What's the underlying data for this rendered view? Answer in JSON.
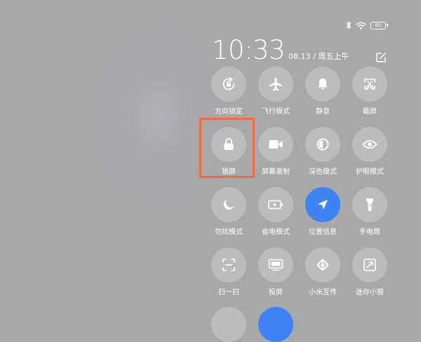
{
  "status_bar": {
    "battery": "80"
  },
  "header": {
    "time": "10:33",
    "date": "08.13 / 周五上午"
  },
  "tiles": [
    {
      "label": "方向锁定",
      "icon": "rotation-lock-icon",
      "active": false
    },
    {
      "label": "飞行模式",
      "icon": "airplane-icon",
      "active": false
    },
    {
      "label": "静音",
      "icon": "bell-icon",
      "active": false
    },
    {
      "label": "截屏",
      "icon": "screenshot-icon",
      "active": false
    },
    {
      "label": "锁屏",
      "icon": "lock-icon",
      "active": false
    },
    {
      "label": "屏幕录制",
      "icon": "video-camera-icon",
      "active": false
    },
    {
      "label": "深色模式",
      "icon": "dark-mode-icon",
      "active": false
    },
    {
      "label": "护眼模式",
      "icon": "eye-icon",
      "active": false
    },
    {
      "label": "勿扰模式",
      "icon": "moon-icon",
      "active": false
    },
    {
      "label": "省电模式",
      "icon": "battery-saver-icon",
      "active": false
    },
    {
      "label": "位置信息",
      "icon": "location-arrow-icon",
      "active": true
    },
    {
      "label": "手电筒",
      "icon": "flashlight-icon",
      "active": false
    },
    {
      "label": "扫一扫",
      "icon": "scan-icon",
      "active": false
    },
    {
      "label": "投屏",
      "icon": "cast-screen-icon",
      "active": false
    },
    {
      "label": "小米互传",
      "icon": "mi-share-icon",
      "active": false
    },
    {
      "label": "迷你小窗",
      "icon": "mini-window-icon",
      "active": false
    },
    {
      "label": "",
      "icon": "",
      "active": false
    },
    {
      "label": "",
      "icon": "",
      "active": true
    }
  ],
  "colors": {
    "background": "#a8a8a8",
    "tile_inactive": "#bcbcbc",
    "tile_active": "#3d83f4",
    "highlight": "#f26a3d"
  }
}
